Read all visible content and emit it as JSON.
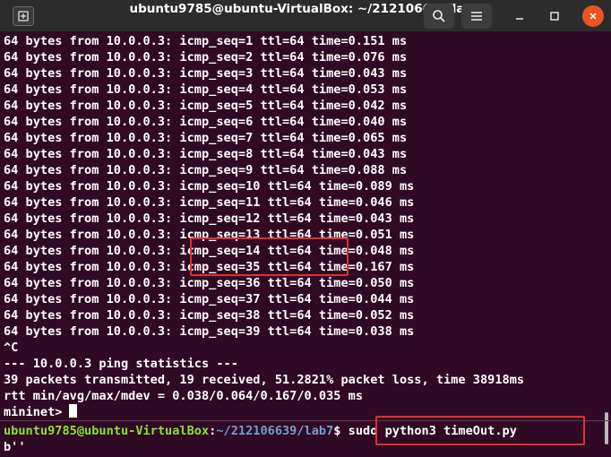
{
  "window": {
    "title": "ubuntu9785@ubuntu-VirtualBox: ~/212106639/lab7",
    "icons": {
      "new_tab": "new-tab-icon",
      "search": "search-icon",
      "menu": "hamburger-menu-icon",
      "minimize": "minimize-icon",
      "maximize": "maximize-icon",
      "close": "close-icon"
    }
  },
  "terminal": {
    "lines": [
      "64 bytes from 10.0.0.3: icmp_seq=1 ttl=64 time=0.151 ms",
      "64 bytes from 10.0.0.3: icmp_seq=2 ttl=64 time=0.076 ms",
      "64 bytes from 10.0.0.3: icmp_seq=3 ttl=64 time=0.043 ms",
      "64 bytes from 10.0.0.3: icmp_seq=4 ttl=64 time=0.053 ms",
      "64 bytes from 10.0.0.3: icmp_seq=5 ttl=64 time=0.042 ms",
      "64 bytes from 10.0.0.3: icmp_seq=6 ttl=64 time=0.040 ms",
      "64 bytes from 10.0.0.3: icmp_seq=7 ttl=64 time=0.065 ms",
      "64 bytes from 10.0.0.3: icmp_seq=8 ttl=64 time=0.043 ms",
      "64 bytes from 10.0.0.3: icmp_seq=9 ttl=64 time=0.088 ms",
      "64 bytes from 10.0.0.3: icmp_seq=10 ttl=64 time=0.089 ms",
      "64 bytes from 10.0.0.3: icmp_seq=11 ttl=64 time=0.046 ms",
      "64 bytes from 10.0.0.3: icmp_seq=12 ttl=64 time=0.043 ms",
      "64 bytes from 10.0.0.3: icmp_seq=13 ttl=64 time=0.051 ms",
      "64 bytes from 10.0.0.3: icmp_seq=14 ttl=64 time=0.048 ms",
      "64 bytes from 10.0.0.3: icmp_seq=35 ttl=64 time=0.167 ms",
      "64 bytes from 10.0.0.3: icmp_seq=36 ttl=64 time=0.050 ms",
      "64 bytes from 10.0.0.3: icmp_seq=37 ttl=64 time=0.044 ms",
      "64 bytes from 10.0.0.3: icmp_seq=38 ttl=64 time=0.052 ms",
      "64 bytes from 10.0.0.3: icmp_seq=39 ttl=64 time=0.038 ms",
      "^C",
      "--- 10.0.0.3 ping statistics ---",
      "39 packets transmitted, 19 received, 51.2821% packet loss, time 38918ms",
      "rtt min/avg/max/mdev = 0.038/0.064/0.167/0.035 ms"
    ],
    "mininet_prompt": "mininet>",
    "bottom_prompt": {
      "user_host": "ubuntu9785@ubuntu-VirtualBox",
      "colon": ":",
      "path": "~/212106639/lab7",
      "dollar": "$",
      "command": " sudo python3 timeOut.py"
    },
    "output_line": "b''"
  },
  "colors": {
    "background": "#300a24",
    "titlebar": "#2c2c2c",
    "prompt_user": "#8ae234",
    "prompt_path": "#729fcf",
    "highlight_box": "#e03030",
    "close_button": "#e95420"
  }
}
